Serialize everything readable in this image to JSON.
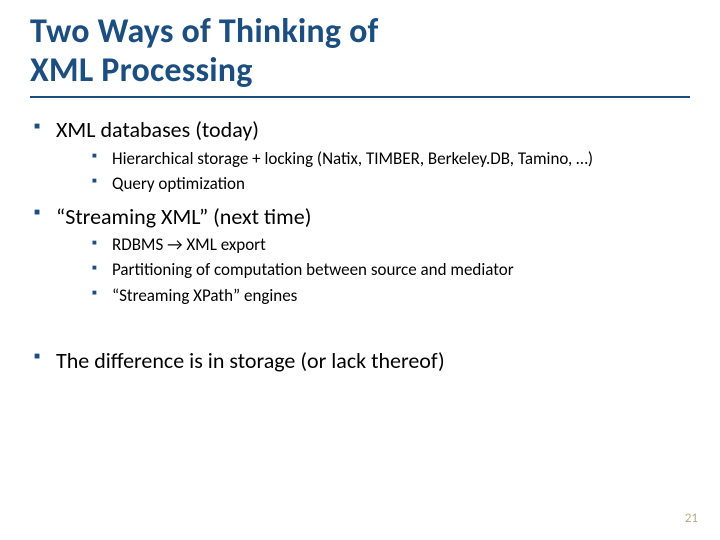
{
  "title_line1": "Two Ways of Thinking of",
  "title_line2": "XML Processing",
  "bullets": {
    "b1": "XML databases (today)",
    "b1_sub": {
      "s1": "Hierarchical storage + locking (Natix, TIMBER, Berkeley.DB, Tamino, …)",
      "s2": "Query optimization"
    },
    "b2": "“Streaming XML” (next time)",
    "b2_sub": {
      "s1": "RDBMS → XML export",
      "s2": "Partitioning of computation between source and mediator",
      "s3": "“Streaming XPath” engines"
    },
    "b3": "The difference is in storage (or lack thereof)"
  },
  "page_number": "21"
}
